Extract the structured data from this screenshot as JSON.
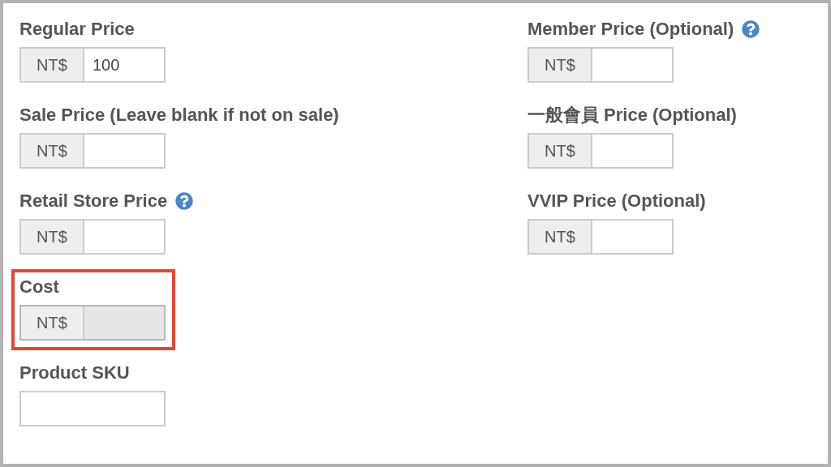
{
  "columns": [
    {
      "fields": [
        {
          "label": "Regular Price",
          "help": false,
          "prefix": "NT$",
          "value": "100",
          "disabled": false,
          "highlighted": false
        },
        {
          "label": "Sale Price (Leave blank if not on sale)",
          "help": false,
          "prefix": "NT$",
          "disabled": false,
          "highlighted": false
        },
        {
          "label": "Retail Store Price",
          "help": true,
          "prefix": "NT$",
          "disabled": false,
          "highlighted": false
        },
        {
          "label": "Cost",
          "help": false,
          "prefix": "NT$",
          "disabled": true,
          "highlighted": true
        },
        {
          "label": "Product SKU",
          "help": false,
          "disabled": false,
          "highlighted": false
        }
      ]
    },
    {
      "fields": [
        {
          "label": "Member Price (Optional)",
          "help": true,
          "prefix": "NT$",
          "disabled": false,
          "highlighted": false
        },
        {
          "label": "一般會員 Price (Optional)",
          "help": false,
          "prefix": "NT$",
          "disabled": false,
          "highlighted": false
        },
        {
          "label": "VVIP Price (Optional)",
          "help": false,
          "prefix": "NT$",
          "disabled": false,
          "highlighted": false
        }
      ]
    }
  ]
}
